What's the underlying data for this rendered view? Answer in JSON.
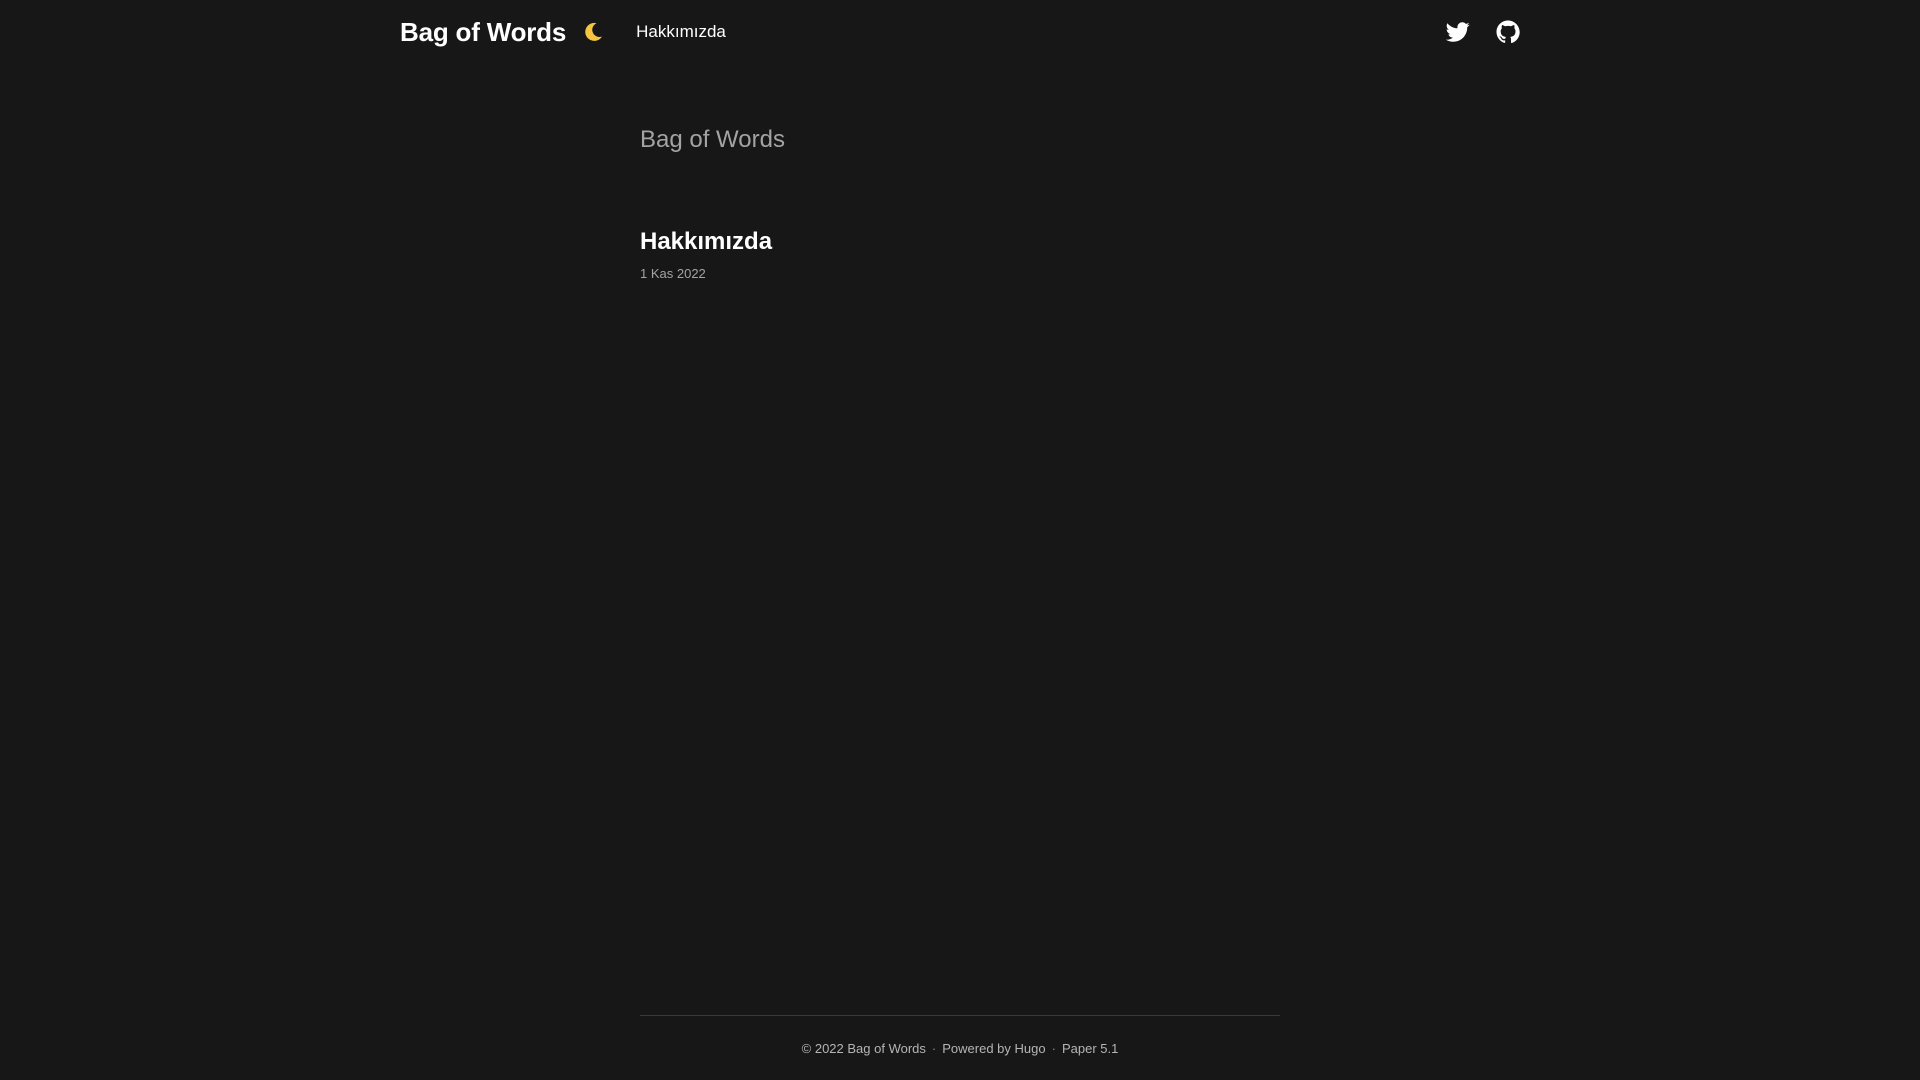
{
  "header": {
    "brand": "Bag of Words",
    "theme_toggle_icon": "moon-icon",
    "nav": [
      {
        "label": "Hakkımızda"
      }
    ],
    "social": [
      {
        "icon": "twitter-icon"
      },
      {
        "icon": "github-icon"
      }
    ]
  },
  "main": {
    "home_title": "Bag of Words",
    "posts": [
      {
        "title": "Hakkımızda",
        "date": "1 Kas 2022"
      }
    ]
  },
  "footer": {
    "copyright": "© 2022 Bag of Words",
    "separator": "·",
    "powered_prefix": "Powered by",
    "powered_link": "Hugo",
    "theme_link": "Paper 5.1"
  },
  "colors": {
    "background": "#171717",
    "moon": "#f5c542",
    "muted_text": "#a3a3a3"
  }
}
